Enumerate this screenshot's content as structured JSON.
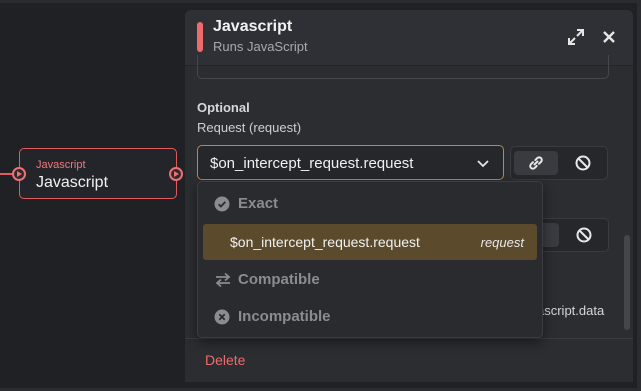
{
  "node": {
    "type_label": "Javascript",
    "name": "Javascript"
  },
  "panel": {
    "title": "Javascript",
    "subtitle": "Runs JavaScript",
    "section_label": "Optional",
    "field_label": "Request (request)",
    "select_value": "$on_intercept_request.request",
    "partial_text": "ascript.data",
    "delete_label": "Delete"
  },
  "dropdown": {
    "groups": {
      "exact": "Exact",
      "compatible": "Compatible",
      "incompatible": "Incompatible"
    },
    "options": [
      {
        "value": "$on_intercept_request.request",
        "tag": "request"
      }
    ]
  },
  "colors": {
    "accent": "#ef6b6b",
    "highlight": "#5b4a2c",
    "select_border": "#b88a3b"
  },
  "icons": [
    "expand-icon",
    "close-icon",
    "chevron-down-icon",
    "link-icon",
    "ban-icon",
    "check-circle-icon",
    "swap-icon",
    "x-circle-icon"
  ]
}
